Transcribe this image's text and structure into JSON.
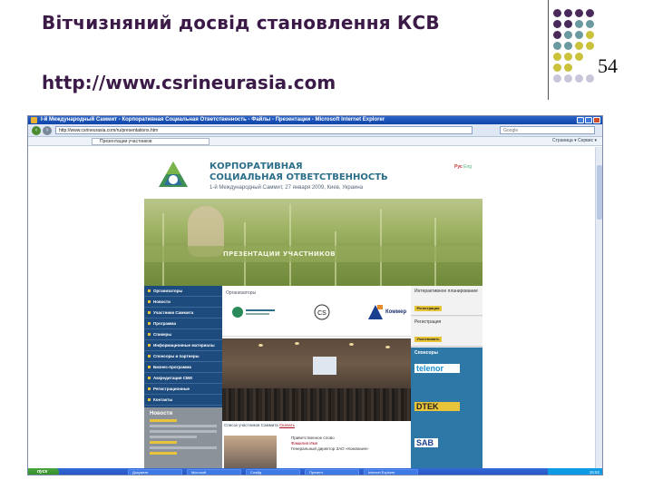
{
  "slide": {
    "title": "Вітчизняний досвід становлення КСВ",
    "url": "http://www.csrineurasia.com",
    "page_number": "54"
  },
  "browser": {
    "window_title": "I-й Международный Саммит - Корпоративная Социальная Ответственность - Файлы - Презентации - Microsoft Internet Explorer",
    "address": "http://www.csrineurasia.com/ru/presentations.htm",
    "search_placeholder": "Google",
    "tab_label": "Презентации участников",
    "tools_label": "Страница ▾  Сервис ▾"
  },
  "site": {
    "title_line1": "КОРПОРАТИВНАЯ",
    "title_line2": "СОЦИАЛЬНАЯ ОТВЕТСТВЕННОСТЬ",
    "subtitle": "1-й Международный Саммит, 27 января 2009, Киев, Украина",
    "lang_ru": "Рус",
    "lang_en": "Eng",
    "banner_text": "ПРЕЗЕНТАЦИИ УЧАСТНИКОВ",
    "nav_items": [
      "Организаторы",
      "Новости",
      "Участники Саммита",
      "Программа",
      "Спикеры",
      "Информационные материалы",
      "Спонсоры и партнеры",
      "Бизнес-программа",
      "Аккредитация СМИ",
      "Регистрационные",
      "Контакты"
    ],
    "news_title": "Новости",
    "partners_label": "Организаторы",
    "commer_label": "Коммер",
    "photo_caption_prefix": "Список участников Саммита ",
    "photo_caption_link": "Скачать",
    "greeting_lines": [
      "Приветственное слово",
      "Фамилия Имя",
      "Генеральный директор ЗАО «Компания»"
    ],
    "right_box1_title": "Интерактивное планирование",
    "right_box1_button": "Регистрация",
    "right_box2_title": "Регистрация",
    "right_box2_button": "Участвовать",
    "sponsors_label": "Спонсоры",
    "sponsor_logos": [
      "telenor",
      "DTEK",
      "SAB"
    ]
  },
  "taskbar": {
    "start_label": "пуск",
    "tasks": [
      "Документ",
      "Microsoft",
      "Слайд",
      "Презент",
      "Internet Explorer"
    ],
    "clock": "15:52"
  },
  "colors": {
    "slide_text": "#3b1a48",
    "dot_purple": "#4a2a5a",
    "dot_teal": "#6a9aa0",
    "dot_yellow": "#c9c23a",
    "dot_lavender": "#c9c6da",
    "site_accent": "#2a6e8a",
    "nav_bg": "#1e4b7d",
    "highlight": "#e8c43a"
  }
}
